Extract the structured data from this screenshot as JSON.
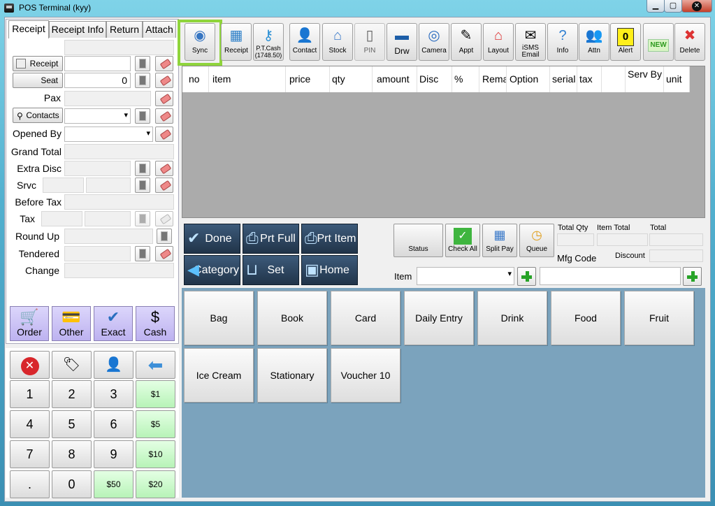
{
  "window": {
    "title": "POS Terminal (kyy)"
  },
  "tabs": [
    "Receipt",
    "Receipt Info",
    "Return",
    "Attach"
  ],
  "form": {
    "receipt_btn": "Receipt",
    "seat_btn": "Seat",
    "seat_value": "0",
    "pax": "Pax",
    "contacts_btn": "Contacts",
    "opened_by": "Opened By",
    "grand_total": "Grand Total",
    "extra_disc": "Extra Disc",
    "srvc": "Srvc",
    "before_tax": "Before Tax",
    "tax": "Tax",
    "round_up": "Round Up",
    "tendered": "Tendered",
    "change": "Change"
  },
  "payments": [
    "Order",
    "Other",
    "Exact",
    "Cash"
  ],
  "keypad": {
    "digits": [
      "1",
      "2",
      "3",
      "4",
      "5",
      "6",
      "7",
      "8",
      "9",
      ".",
      "0"
    ],
    "money": [
      "$1",
      "$5",
      "$10",
      "$50",
      "$20"
    ]
  },
  "toolbar": [
    {
      "label": "Sync",
      "icon": "sync-icon"
    },
    {
      "label": "Receipt",
      "icon": "receipt-icon"
    },
    {
      "label": "P.T.Cash (1748.50)",
      "icon": "key-icon"
    },
    {
      "label": "Contact",
      "icon": "contact-icon"
    },
    {
      "label": "Stock",
      "icon": "house-icon"
    },
    {
      "label": "PIN",
      "icon": "phone-icon"
    },
    {
      "label": "Drw",
      "icon": "drawer-icon"
    },
    {
      "label": "Camera",
      "icon": "camera-icon"
    },
    {
      "label": "Appt",
      "icon": "appointment-icon"
    },
    {
      "label": "Layout",
      "icon": "shop-icon"
    },
    {
      "label": "iSMS Email",
      "icon": "email-icon"
    },
    {
      "label": "Info",
      "icon": "help-icon"
    },
    {
      "label": "Attn",
      "icon": "attendance-icon"
    },
    {
      "label": "Alert",
      "icon": "alert-icon",
      "badge": "0"
    },
    {
      "label": "NEW",
      "icon": "new-icon"
    },
    {
      "label": "Delete",
      "icon": "delete-icon"
    }
  ],
  "grid_columns": [
    {
      "text": "no"
    },
    {
      "text": "item"
    },
    {
      "text": "price"
    },
    {
      "text": "qty"
    },
    {
      "text": "amount"
    },
    {
      "text": "Disc"
    },
    {
      "text": "%"
    },
    {
      "text": "Remark"
    },
    {
      "text": "Option"
    },
    {
      "text": "serial"
    },
    {
      "text": "tax"
    },
    {
      "text": ""
    },
    {
      "text": "Serv By"
    },
    {
      "text": "unit"
    }
  ],
  "actions": {
    "done": "Done",
    "prt_full": "Prt Full",
    "prt_item": "Prt Item",
    "category": "Category",
    "set": "Set",
    "home": "Home"
  },
  "mid_buttons": {
    "status": "Status",
    "check_all": "Check All",
    "split_pay": "Split Pay",
    "queue": "Queue"
  },
  "summary": {
    "total_qty": "Total Qty",
    "item_total": "Item Total",
    "total": "Total",
    "mfg_code": "Mfg Code",
    "discount": "Discount",
    "item": "Item"
  },
  "categories": [
    "Bag",
    "Book",
    "Card",
    "Daily Entry",
    "Drink",
    "Food",
    "Fruit",
    "Ice Cream",
    "Stationary",
    "Voucher 10"
  ],
  "colors": {
    "highlight": "#8fd43b",
    "action_bg": "#2a4058",
    "category_area": "#7ba3bd",
    "payment": "#c7bdf4",
    "money_key": "#c9f7c9"
  }
}
